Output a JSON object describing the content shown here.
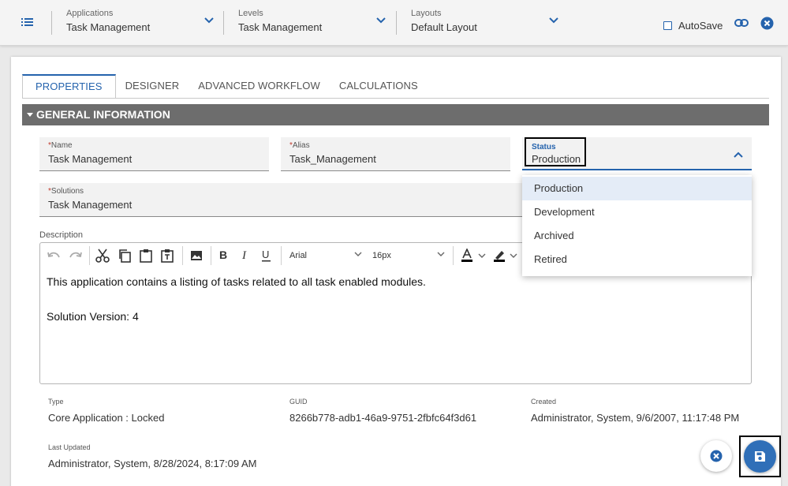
{
  "topbar": {
    "menu_icon": "list-icon",
    "applications": {
      "label": "Applications",
      "value": "Task Management"
    },
    "levels": {
      "label": "Levels",
      "value": "Task Management"
    },
    "layouts": {
      "label": "Layouts",
      "value": "Default Layout"
    },
    "autosave_label": "AutoSave",
    "autosave_checked": false
  },
  "tabs": [
    "PROPERTIES",
    "DESIGNER",
    "ADVANCED WORKFLOW",
    "CALCULATIONS"
  ],
  "active_tab": "PROPERTIES",
  "section": {
    "title": "GENERAL INFORMATION"
  },
  "fields": {
    "name": {
      "label": "Name",
      "required_mark": "*",
      "value": "Task Management"
    },
    "alias": {
      "label": "Alias",
      "required_mark": "*",
      "value": "Task_Management"
    },
    "status": {
      "label": "Status",
      "value": "Production"
    },
    "solutions": {
      "label": "Solutions",
      "required_mark": "*",
      "value": "Task Management"
    }
  },
  "status_options": [
    "Production",
    "Development",
    "Archived",
    "Retired"
  ],
  "description": {
    "label": "Description",
    "font": "Arial",
    "size": "16px",
    "lines": [
      "This application contains a listing of tasks related to all task enabled modules.",
      "",
      "Solution Version: 4"
    ]
  },
  "meta": {
    "type": {
      "label": "Type",
      "value": "Core Application : Locked"
    },
    "guid": {
      "label": "GUID",
      "value": "8266b778-adb1-46a9-9751-2fbfc64f3d61"
    },
    "created": {
      "label": "Created",
      "value": "Administrator, System, 9/6/2007, 11:17:48 PM"
    },
    "last_updated": {
      "label": "Last Updated",
      "value": "Administrator, System, 8/28/2024, 8:17:09 AM"
    }
  },
  "colors": {
    "accent": "#2563ad",
    "section_bg": "#6d6d6d",
    "save_button": "#2f6fb8"
  }
}
